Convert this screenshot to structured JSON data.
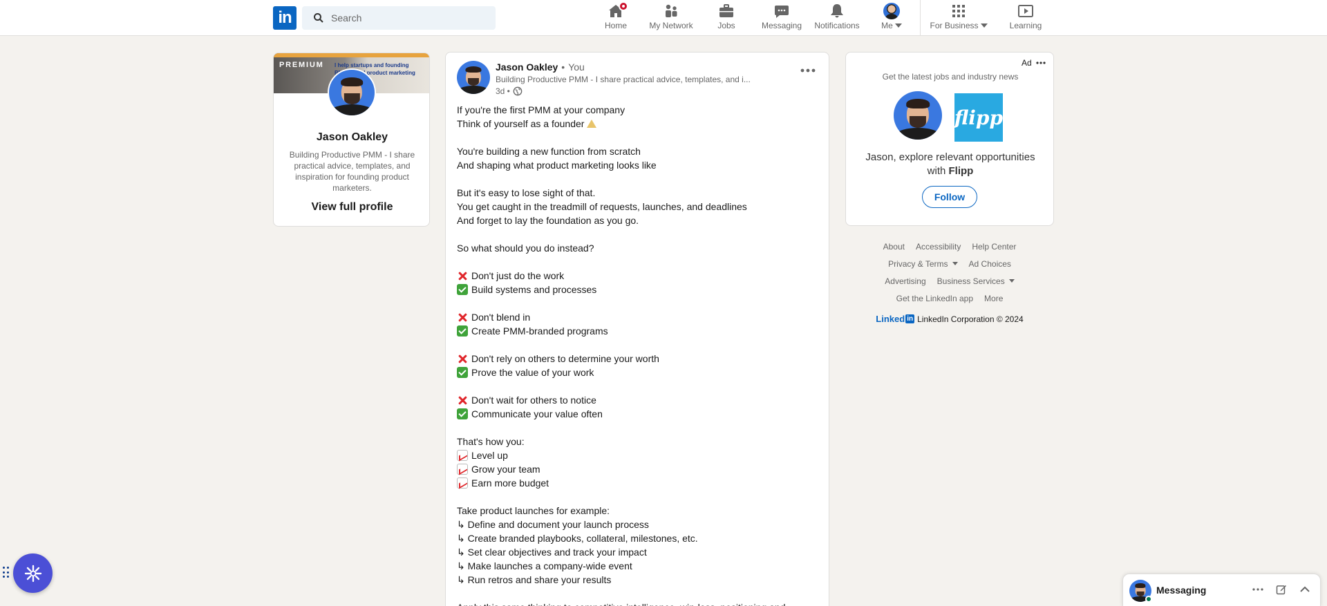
{
  "nav": {
    "logo": "in",
    "search_placeholder": "Search",
    "items": [
      {
        "label": "Home",
        "icon": "home-icon"
      },
      {
        "label": "My Network",
        "icon": "network-icon"
      },
      {
        "label": "Jobs",
        "icon": "jobs-icon"
      },
      {
        "label": "Messaging",
        "icon": "messaging-icon"
      },
      {
        "label": "Notifications",
        "icon": "bell-icon"
      },
      {
        "label": "Me",
        "icon": "avatar"
      },
      {
        "label": "For Business",
        "icon": "grid-icon"
      },
      {
        "label": "Learning",
        "icon": "learning-icon"
      }
    ]
  },
  "profile": {
    "banner_label": "PREMIUM",
    "banner_text": "I help startups and founding PMMs build product marketing from zero",
    "name": "Jason Oakley",
    "headline": "Building Productive PMM - I share practical advice, templates, and inspiration for founding product marketers.",
    "view_profile": "View full profile"
  },
  "post": {
    "author": "Jason Oakley",
    "separator": "•",
    "relation": "You",
    "headline": "Building Productive PMM - I share practical advice, templates, and i...",
    "time": "3d •",
    "body": [
      {
        "t": "If you're the first PMM at your company"
      },
      {
        "t": "Think of yourself as a founder",
        "e_after": "tri"
      },
      {
        "gap": true
      },
      {
        "t": "You're building a new function from scratch"
      },
      {
        "t": "And shaping what product marketing looks like"
      },
      {
        "gap": true
      },
      {
        "t": "But it's easy to lose sight of that."
      },
      {
        "t": "You get caught in the treadmill of requests, launches, and deadlines"
      },
      {
        "t": "And forget to lay the foundation as you go."
      },
      {
        "gap": true
      },
      {
        "t": "So what should you do instead?"
      },
      {
        "gap": true
      },
      {
        "t": "Don't just do the work",
        "e": "x"
      },
      {
        "t": "Build systems and processes",
        "e": "check"
      },
      {
        "gap": true
      },
      {
        "t": "Don't blend in",
        "e": "x"
      },
      {
        "t": "Create PMM-branded programs",
        "e": "check"
      },
      {
        "gap": true
      },
      {
        "t": "Don't rely on others to determine your worth",
        "e": "x"
      },
      {
        "t": "Prove the value of your work",
        "e": "check"
      },
      {
        "gap": true
      },
      {
        "t": "Don't wait for others to notice",
        "e": "x"
      },
      {
        "t": "Communicate your value often",
        "e": "check"
      },
      {
        "gap": true
      },
      {
        "t": "That's how you:"
      },
      {
        "t": "Level up",
        "e": "chart"
      },
      {
        "t": "Grow your team",
        "e": "chart"
      },
      {
        "t": "Earn more budget",
        "e": "chart"
      },
      {
        "gap": true
      },
      {
        "t": "Take product launches for example:"
      },
      {
        "t": "↳ Define and document your launch process"
      },
      {
        "t": "↳ Create branded playbooks, collateral, milestones, etc."
      },
      {
        "t": "↳ Set clear objectives and track your impact"
      },
      {
        "t": "↳ Make launches a company-wide event"
      },
      {
        "t": "↳ Run retros and share your results"
      },
      {
        "gap": true
      },
      {
        "t": "Apply this same thinking to competitive intelligence, win-loss, positioning and"
      }
    ]
  },
  "ad": {
    "label": "Ad",
    "tagline": "Get the latest jobs and industry news",
    "logo_text": "flipp",
    "message_prefix": "Jason, explore relevant opportunities with",
    "company": "Flipp",
    "follow": "Follow"
  },
  "footer": {
    "row1": [
      "About",
      "Accessibility",
      "Help Center"
    ],
    "row2": [
      "Privacy & Terms",
      "Ad Choices"
    ],
    "row3": [
      "Advertising",
      "Business Services"
    ],
    "row4": [
      "Get the LinkedIn app",
      "More"
    ],
    "brand_word": "Linked",
    "brand_in": "in",
    "copyright": "LinkedIn Corporation © 2024"
  },
  "messaging": {
    "title": "Messaging"
  },
  "colors": {
    "brand": "#0a66c2",
    "background": "#f4f2ee",
    "notification_badge": "#cb112d",
    "floating_button": "#4b4fd6"
  }
}
